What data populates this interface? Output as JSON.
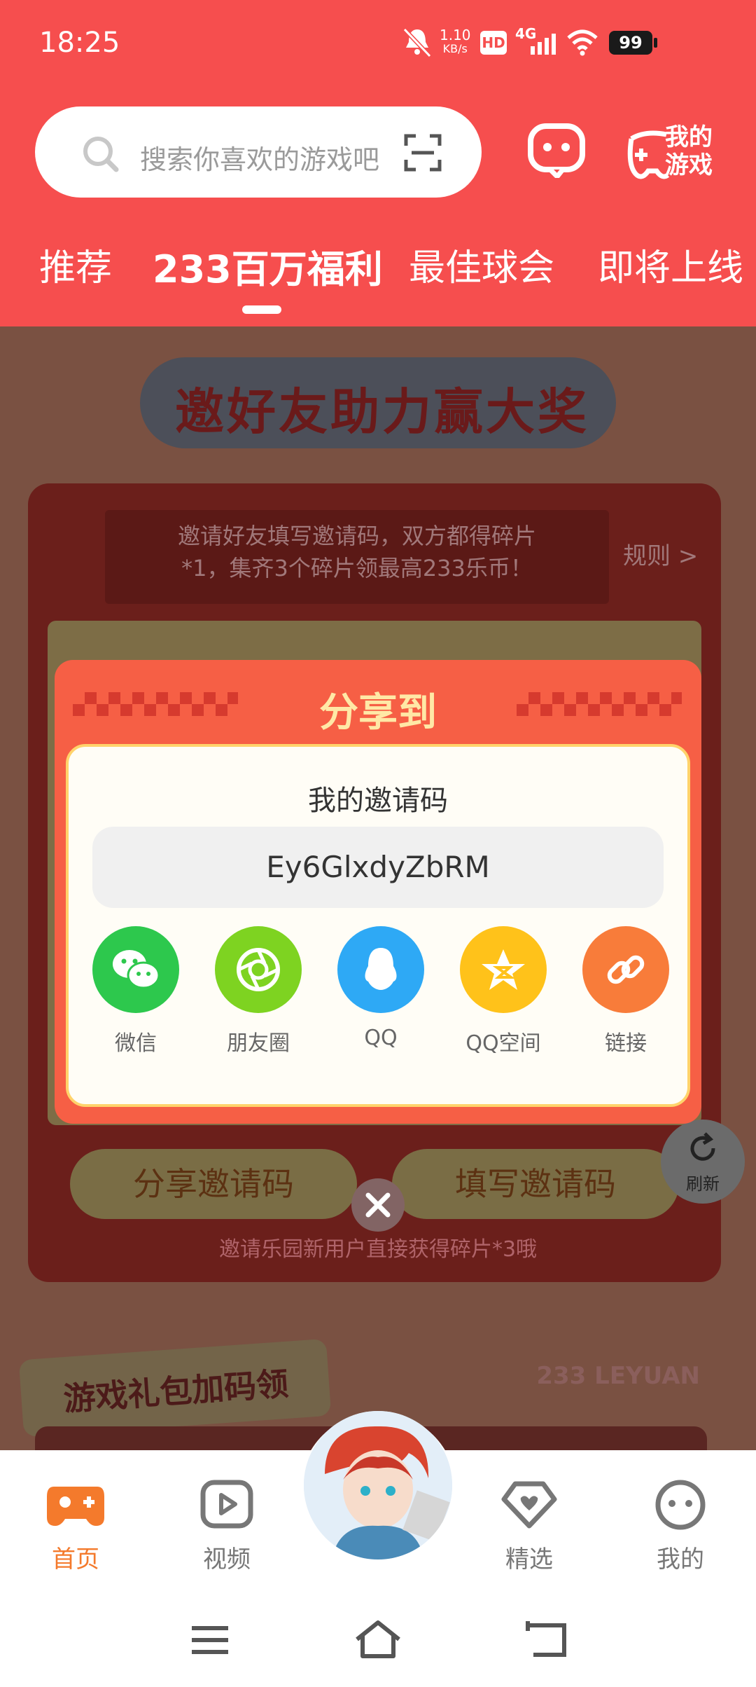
{
  "status_bar": {
    "time": "18:25",
    "net_speed": "1.10\nKB/s",
    "hd": "HD",
    "network": "4G",
    "battery": "99"
  },
  "header": {
    "search_placeholder": "搜索你喜欢的游戏吧",
    "my_games_label_line1": "我的",
    "my_games_label_line2": "游戏"
  },
  "tabs": [
    {
      "label": "推荐"
    },
    {
      "label": "233百万福利"
    },
    {
      "label": "最佳球会"
    },
    {
      "label": "即将上线"
    }
  ],
  "page": {
    "banner_title": "邀好友助力赢大奖",
    "notice_line1": "邀请好友填写邀请码，双方都得碎片",
    "notice_line2": "*1，集齐3个碎片领最高233乐币！",
    "rules_link": "规则 >",
    "share_code_button": "分享邀请码",
    "enter_code_button": "填写邀请码",
    "hint": "邀请乐园新用户直接获得碎片*3哦",
    "refresh_label": "刷新",
    "gift_title": "游戏礼包加码领",
    "brand": "233 LEYUAN"
  },
  "modal": {
    "title": "分享到",
    "code_label": "我的邀请码",
    "code_value": "Ey6GlxdyZbRM",
    "share_options": [
      {
        "label": "微信",
        "color": "#2DC84D",
        "icon": "wechat-icon"
      },
      {
        "label": "朋友圈",
        "color": "#7ED321",
        "icon": "moments-icon"
      },
      {
        "label": "QQ",
        "color": "#2EA9F5",
        "icon": "qq-icon"
      },
      {
        "label": "QQ空间",
        "color": "#FFC21A",
        "icon": "qzone-icon"
      },
      {
        "label": "链接",
        "color": "#F87C3A",
        "icon": "link-icon"
      }
    ]
  },
  "bottom_nav": [
    {
      "label": "首页",
      "active": true
    },
    {
      "label": "视频"
    },
    {
      "label": "精选"
    },
    {
      "label": "我的"
    }
  ],
  "colors": {
    "brand_red": "#F64E4E",
    "accent_orange": "#F47A2C",
    "modal_red": "#F65F45"
  }
}
